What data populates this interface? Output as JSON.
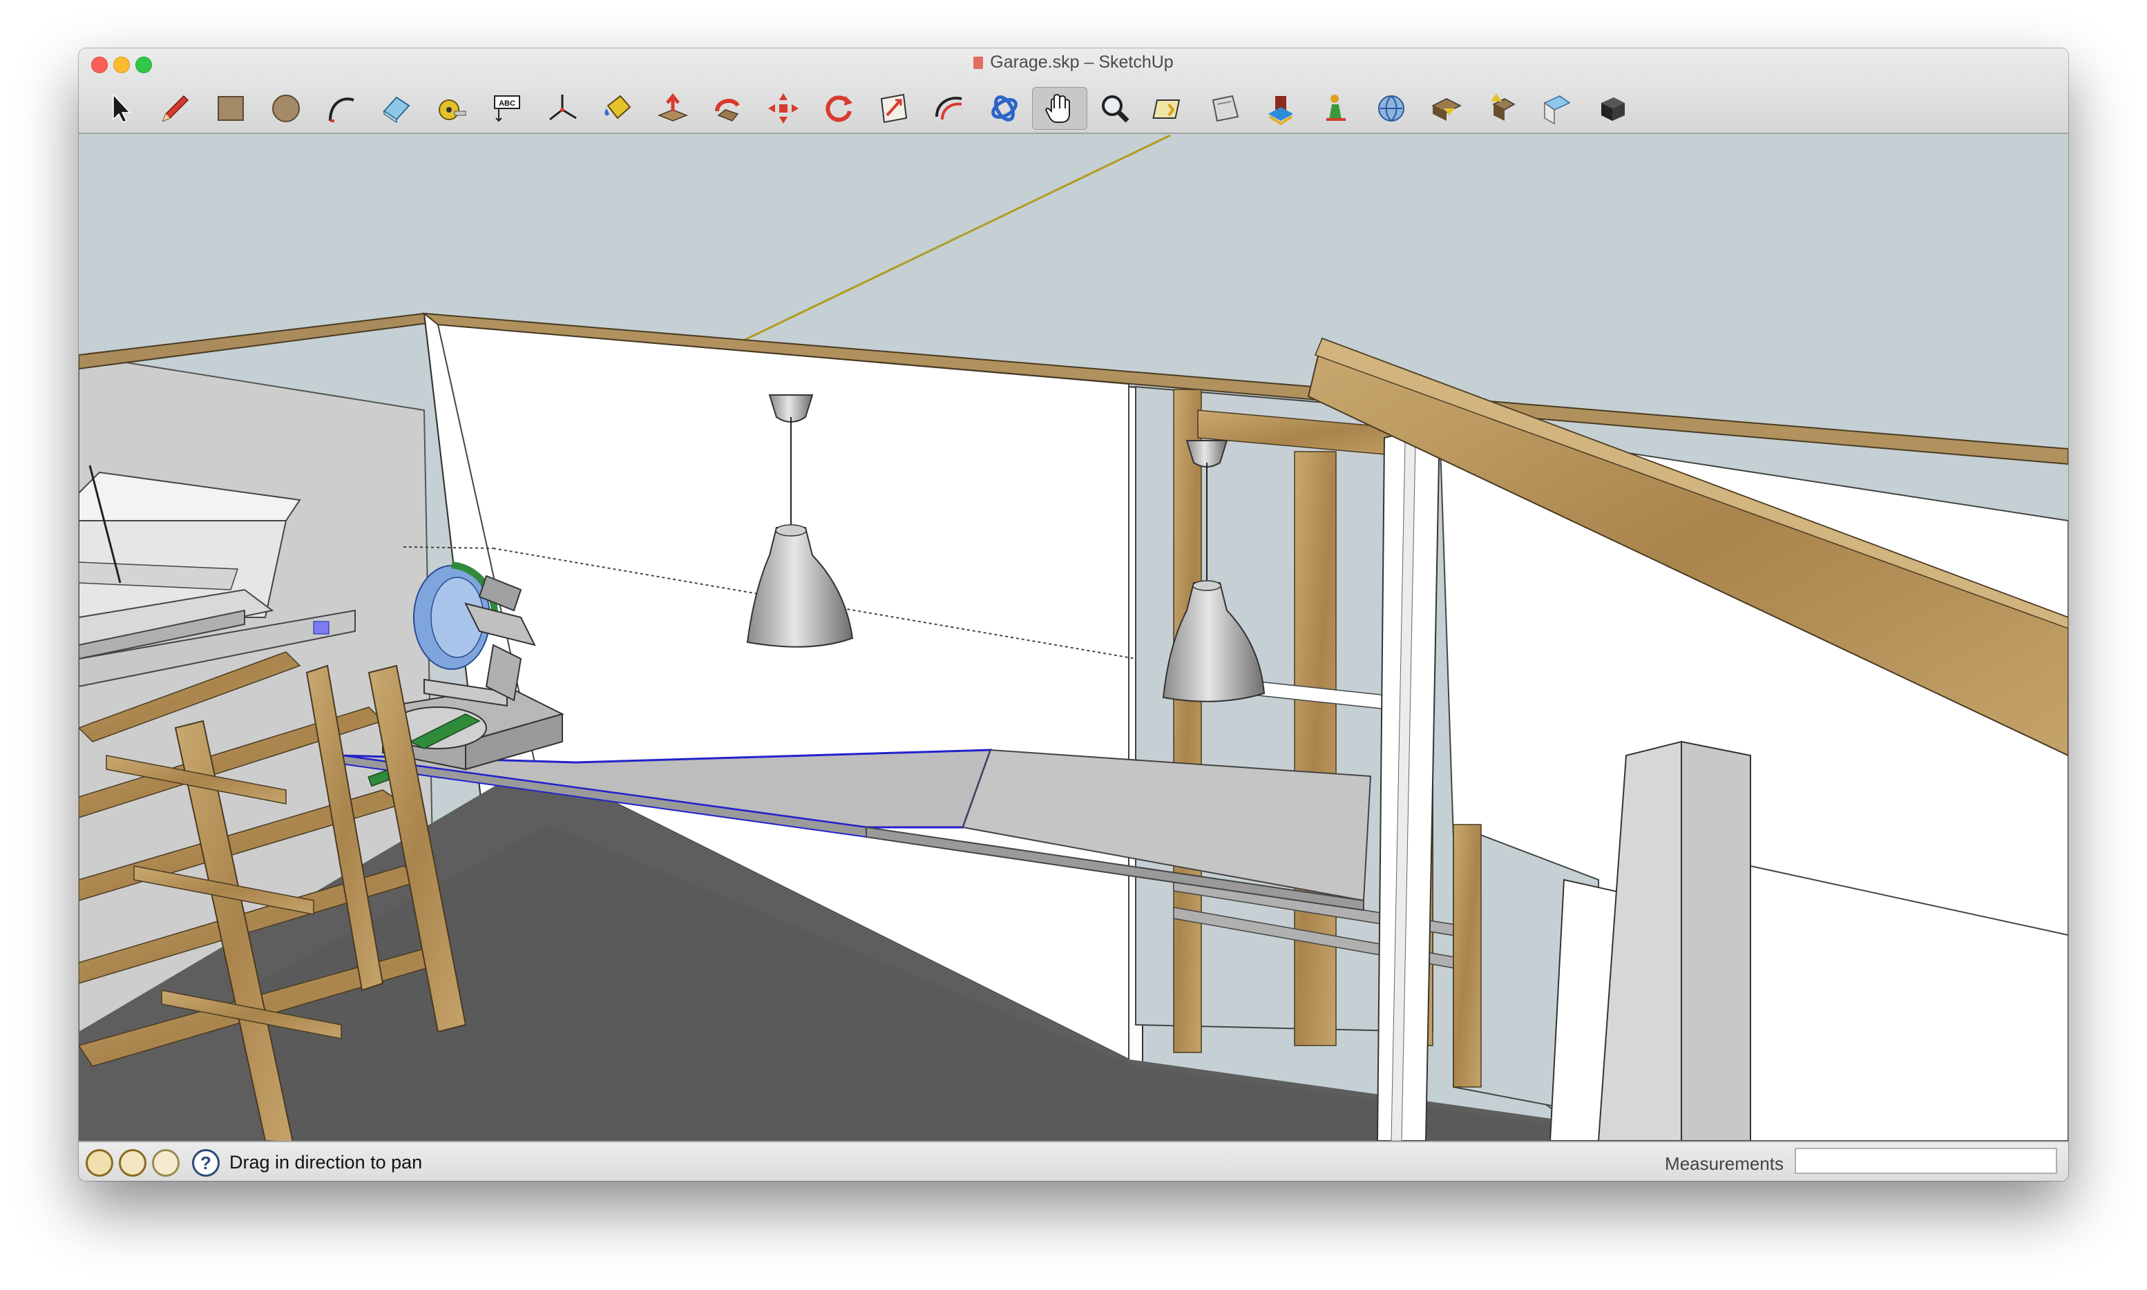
{
  "window": {
    "title": "Garage.skp – SketchUp",
    "traffic_lights": [
      {
        "name": "close",
        "color": "#fc5f57"
      },
      {
        "name": "minimize",
        "color": "#fdbc2e"
      },
      {
        "name": "zoom",
        "color": "#33c748"
      }
    ]
  },
  "toolbar": {
    "tools": [
      {
        "name": "select-tool",
        "icon": "arrow-cursor-icon"
      },
      {
        "name": "line-tool",
        "icon": "pencil-icon"
      },
      {
        "name": "rectangle-tool",
        "icon": "rectangle-icon"
      },
      {
        "name": "circle-tool",
        "icon": "circle-icon"
      },
      {
        "name": "arc-tool",
        "icon": "arc-icon"
      },
      {
        "name": "eraser-tool",
        "icon": "eraser-icon"
      },
      {
        "name": "tape-measure-tool",
        "icon": "tape-measure-icon"
      },
      {
        "name": "text-tool",
        "icon": "text-label-icon",
        "label": "ABC"
      },
      {
        "name": "axes-tool",
        "icon": "axes-icon"
      },
      {
        "name": "paint-bucket-tool",
        "icon": "paint-bucket-icon"
      },
      {
        "name": "push-pull-tool",
        "icon": "push-pull-icon"
      },
      {
        "name": "follow-me-tool",
        "icon": "follow-me-icon"
      },
      {
        "name": "move-tool",
        "icon": "move-icon"
      },
      {
        "name": "rotate-tool",
        "icon": "rotate-icon"
      },
      {
        "name": "scale-tool",
        "icon": "scale-icon"
      },
      {
        "name": "offset-tool",
        "icon": "offset-icon"
      },
      {
        "name": "orbit-tool",
        "icon": "orbit-icon"
      },
      {
        "name": "pan-tool",
        "icon": "hand-icon",
        "active": true
      },
      {
        "name": "zoom-tool",
        "icon": "magnifier-icon"
      },
      {
        "name": "walk-tool",
        "icon": "walk-icon"
      },
      {
        "name": "section-plane-tool",
        "icon": "section-plane-icon"
      },
      {
        "name": "get-models-tool",
        "icon": "warehouse-icon"
      },
      {
        "name": "extension-tool",
        "icon": "extension-icon"
      },
      {
        "name": "geo-location-tool",
        "icon": "globe-icon"
      },
      {
        "name": "share-model-tool",
        "icon": "share-model-icon"
      },
      {
        "name": "share-component-tool",
        "icon": "share-component-icon"
      },
      {
        "name": "preview-tool",
        "icon": "preview-icon"
      },
      {
        "name": "layout-tool",
        "icon": "cube-icon"
      }
    ]
  },
  "statusbar": {
    "icons": [
      "geo-location-status-icon",
      "credits-status-icon",
      "user-status-icon",
      "help-icon"
    ],
    "help_glyph": "?",
    "message": "Drag in direction to pan",
    "measurements_label": "Measurements",
    "measurements_value": ""
  },
  "colors": {
    "sky": "#c4d0d3",
    "floor": "#5e5e5e",
    "wood": "#b9965c",
    "selection": "#2222cc",
    "accent_green": "#2f8a3a"
  }
}
